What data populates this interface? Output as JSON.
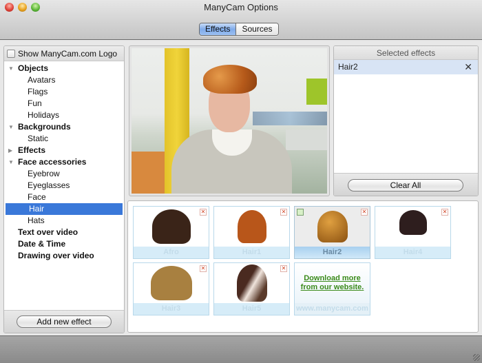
{
  "window": {
    "title": "ManyCam Options",
    "controls": [
      "close",
      "minimize",
      "zoom"
    ]
  },
  "toolbar": {
    "tabs": [
      {
        "label": "Effects",
        "active": true
      },
      {
        "label": "Sources",
        "active": false
      }
    ]
  },
  "sidebar": {
    "show_logo_label": "Show ManyCam.com Logo",
    "show_logo_checked": false,
    "tree": [
      {
        "label": "Objects",
        "type": "category",
        "expanded": true
      },
      {
        "label": "Avatars",
        "type": "sub"
      },
      {
        "label": "Flags",
        "type": "sub"
      },
      {
        "label": "Fun",
        "type": "sub"
      },
      {
        "label": "Holidays",
        "type": "sub"
      },
      {
        "label": "Backgrounds",
        "type": "category",
        "expanded": true
      },
      {
        "label": "Static",
        "type": "sub"
      },
      {
        "label": "Effects",
        "type": "category",
        "expanded": false
      },
      {
        "label": "Face accessories",
        "type": "category",
        "expanded": true
      },
      {
        "label": "Eyebrow",
        "type": "sub"
      },
      {
        "label": "Eyeglasses",
        "type": "sub"
      },
      {
        "label": "Face",
        "type": "sub"
      },
      {
        "label": "Hair",
        "type": "sub",
        "selected": true
      },
      {
        "label": "Hats",
        "type": "sub"
      },
      {
        "label": "Text over video",
        "type": "leaf-category"
      },
      {
        "label": "Date & Time",
        "type": "leaf-category"
      },
      {
        "label": "Drawing over video",
        "type": "leaf-category"
      }
    ],
    "add_button": "Add new effect"
  },
  "selected_effects": {
    "header": "Selected effects",
    "items": [
      {
        "label": "Hair2",
        "remove_icon": "close-x-icon"
      }
    ],
    "clear_button": "Clear All"
  },
  "gallery": {
    "tiles": [
      {
        "label": "Afro",
        "active": false,
        "color": "#3a2418"
      },
      {
        "label": "Hair1",
        "active": false,
        "color": "#b8561a"
      },
      {
        "label": "Hair2",
        "active": true,
        "color": "#b87528"
      },
      {
        "label": "Hair4",
        "active": false,
        "color": "#2e1e1e"
      },
      {
        "label": "Hair3",
        "active": false,
        "color": "#a88040"
      },
      {
        "label": "Hair5",
        "active": false,
        "color": "#6a4436"
      }
    ],
    "download": {
      "line1": "Download more",
      "line2": "from our website",
      "footer": "www.manycam.com"
    }
  }
}
